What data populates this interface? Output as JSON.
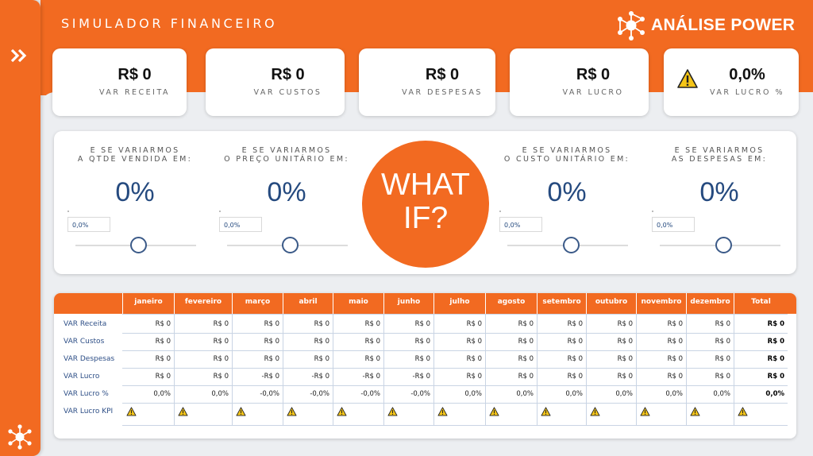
{
  "app": {
    "title": "SIMULADOR FINANCEIRO",
    "brand": "ANÁLISE POWER",
    "expand_icon": "double-chevron-right-icon",
    "accent": "#f26a21",
    "value_color": "#254a7f"
  },
  "kpis": [
    {
      "value": "R$ 0",
      "label": "VAR RECEITA"
    },
    {
      "value": "R$ 0",
      "label": "VAR CUSTOS"
    },
    {
      "value": "R$ 0",
      "label": "VAR DESPESAS"
    },
    {
      "value": "R$ 0",
      "label": "VAR LUCRO"
    },
    {
      "value": "0,0%",
      "label": "VAR LUCRO %",
      "icon": "warning-icon"
    }
  ],
  "whatif": {
    "center_line1": "WHAT",
    "center_line2": "IF?",
    "params": [
      {
        "q1": "E SE VARIARMOS",
        "q2": "A QTDE VENDIDA EM:",
        "pct": "0%",
        "input": "0,0%",
        "slider": 0
      },
      {
        "q1": "E SE VARIARMOS",
        "q2": "O PREÇO UNITÁRIO EM:",
        "pct": "0%",
        "input": "0,0%",
        "slider": 0
      },
      {
        "q1": "E SE VARIARMOS",
        "q2": "O CUSTO UNITÁRIO EM:",
        "pct": "0%",
        "input": "0,0%",
        "slider": 0
      },
      {
        "q1": "E SE VARIARMOS",
        "q2": "AS DESPESAS EM:",
        "pct": "0%",
        "input": "0,0%",
        "slider": 0
      }
    ]
  },
  "table": {
    "columns": [
      "janeiro",
      "fevereiro",
      "março",
      "abril",
      "maio",
      "junho",
      "julho",
      "agosto",
      "setembro",
      "outubro",
      "novembro",
      "dezembro",
      "Total"
    ],
    "rows": [
      {
        "label": "VAR Receita",
        "cells": [
          "R$ 0",
          "R$ 0",
          "R$ 0",
          "R$ 0",
          "R$ 0",
          "R$ 0",
          "R$ 0",
          "R$ 0",
          "R$ 0",
          "R$ 0",
          "R$ 0",
          "R$ 0",
          "R$ 0"
        ]
      },
      {
        "label": "VAR Custos",
        "cells": [
          "R$ 0",
          "R$ 0",
          "R$ 0",
          "R$ 0",
          "R$ 0",
          "R$ 0",
          "R$ 0",
          "R$ 0",
          "R$ 0",
          "R$ 0",
          "R$ 0",
          "R$ 0",
          "R$ 0"
        ]
      },
      {
        "label": "VAR Despesas",
        "cells": [
          "R$ 0",
          "R$ 0",
          "R$ 0",
          "R$ 0",
          "R$ 0",
          "R$ 0",
          "R$ 0",
          "R$ 0",
          "R$ 0",
          "R$ 0",
          "R$ 0",
          "R$ 0",
          "R$ 0"
        ]
      },
      {
        "label": "VAR Lucro",
        "cells": [
          "R$ 0",
          "R$ 0",
          "-R$ 0",
          "-R$ 0",
          "-R$ 0",
          "-R$ 0",
          "R$ 0",
          "R$ 0",
          "R$ 0",
          "R$ 0",
          "R$ 0",
          "R$ 0",
          "R$ 0"
        ]
      },
      {
        "label": "VAR Lucro %",
        "cells": [
          "0,0%",
          "0,0%",
          "-0,0%",
          "-0,0%",
          "-0,0%",
          "-0,0%",
          "0,0%",
          "0,0%",
          "0,0%",
          "0,0%",
          "0,0%",
          "0,0%",
          "0,0%"
        ]
      },
      {
        "label": "VAR Lucro KPI",
        "icon": "warning-icon",
        "cells": [
          "",
          "",
          "",
          "",
          "",
          "",
          "",
          "",
          "",
          "",
          "",
          "",
          ""
        ]
      }
    ]
  }
}
